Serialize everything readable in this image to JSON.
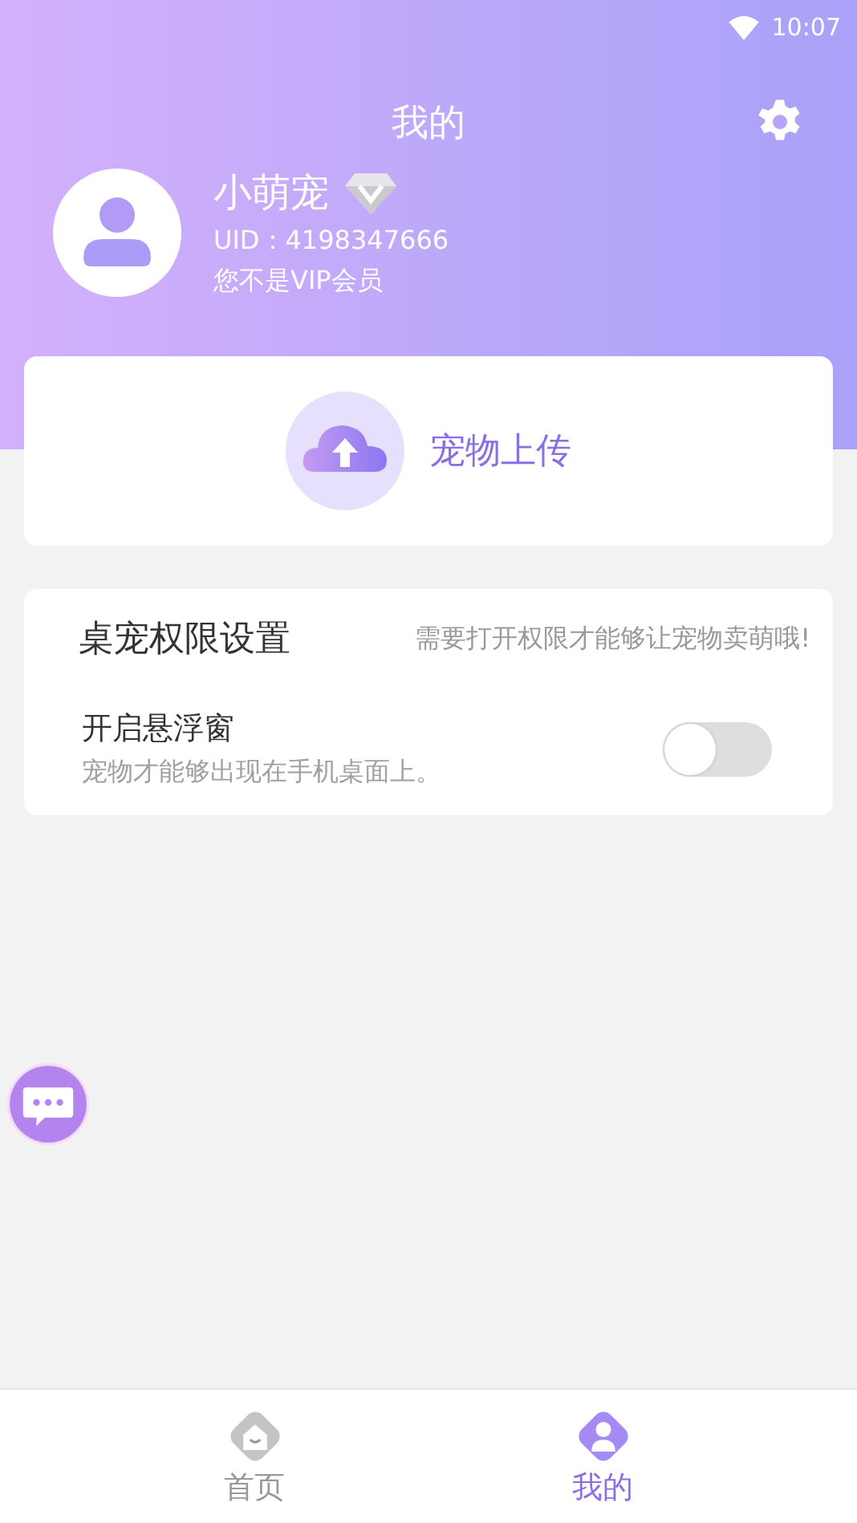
{
  "status_bar": {
    "time": "10:07"
  },
  "header": {
    "title": "我的"
  },
  "profile": {
    "name": "小萌宠",
    "uid": "UID：4198347666",
    "vip_status": "您不是VIP会员"
  },
  "upload": {
    "label": "宠物上传"
  },
  "permissions": {
    "title": "桌宠权限设置",
    "hint": "需要打开权限才能够让宠物卖萌哦!",
    "items": [
      {
        "label": "开启悬浮窗",
        "description": "宠物才能够出现在手机桌面上。",
        "on": false
      }
    ]
  },
  "tabs": [
    {
      "label": "首页",
      "selected": false
    },
    {
      "label": "我的",
      "selected": true
    }
  ]
}
